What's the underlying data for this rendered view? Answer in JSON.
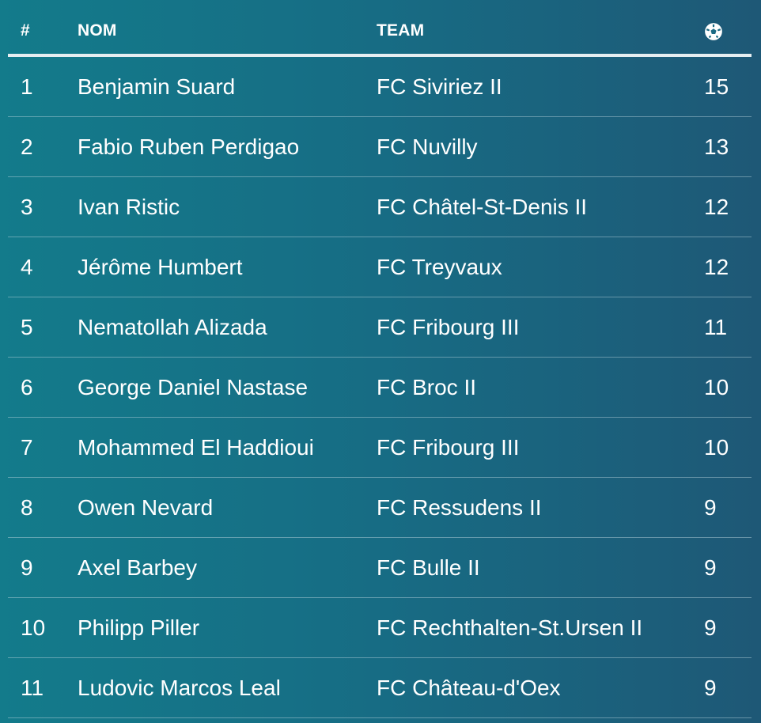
{
  "table": {
    "headers": {
      "rank": "#",
      "name": "NOM",
      "team": "TEAM",
      "goals_icon": "soccer-ball-icon"
    },
    "rows": [
      {
        "rank": "1",
        "name": "Benjamin Suard",
        "team": "FC Siviriez II",
        "goals": "15"
      },
      {
        "rank": "2",
        "name": "Fabio Ruben Perdigao",
        "team": "FC Nuvilly",
        "goals": "13"
      },
      {
        "rank": "3",
        "name": "Ivan Ristic",
        "team": "FC Châtel-St-Denis II",
        "goals": "12"
      },
      {
        "rank": "4",
        "name": "Jérôme Humbert",
        "team": "FC Treyvaux",
        "goals": "12"
      },
      {
        "rank": "5",
        "name": "Nematollah Alizada",
        "team": "FC Fribourg III",
        "goals": "11"
      },
      {
        "rank": "6",
        "name": "George Daniel Nastase",
        "team": "FC Broc II",
        "goals": "10"
      },
      {
        "rank": "7",
        "name": "Mohammed El Haddioui",
        "team": "FC Fribourg III",
        "goals": "10"
      },
      {
        "rank": "8",
        "name": "Owen Nevard",
        "team": "FC Ressudens II",
        "goals": "9"
      },
      {
        "rank": "9",
        "name": "Axel Barbey",
        "team": "FC Bulle II",
        "goals": "9"
      },
      {
        "rank": "10",
        "name": "Philipp Piller",
        "team": "FC Rechthalten-St.Ursen II",
        "goals": "9"
      },
      {
        "rank": "11",
        "name": "Ludovic Marcos Leal",
        "team": "FC Château-d'Oex",
        "goals": "9"
      }
    ]
  },
  "colors": {
    "gradient_start": "#137b8b",
    "gradient_end": "#1e5876",
    "text": "#ffffff"
  }
}
